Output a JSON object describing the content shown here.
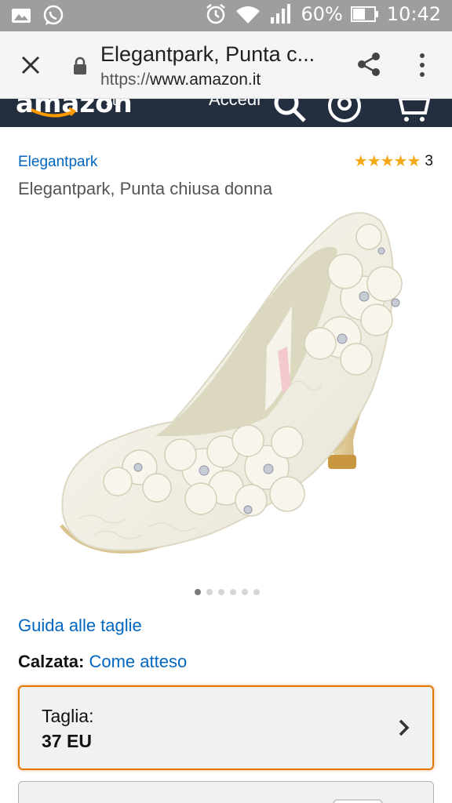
{
  "status_bar": {
    "battery_percent": "60%",
    "time": "10:42",
    "icons": [
      "image-icon",
      "whatsapp-icon",
      "alarm-icon",
      "wifi-icon",
      "signal-icon",
      "battery-icon"
    ]
  },
  "browser": {
    "title": "Elegantpark, Punta c...",
    "url_scheme": "https://",
    "url_host": "www.amazon.it",
    "icons": [
      "close-icon",
      "lock-icon",
      "share-icon",
      "more-vert-icon"
    ]
  },
  "amazon_header": {
    "logo_text": "amazon",
    "logo_tld": ".it",
    "account_text": "Accedi",
    "icons": [
      "search-icon",
      "user-icon",
      "cart-icon"
    ]
  },
  "product": {
    "brand": "Elegantpark",
    "title": "Elegantpark, Punta chiusa donna",
    "stars": "★★★★★",
    "rating_value": 5,
    "rating_count": "3",
    "image_count": 6,
    "active_image_index": 0
  },
  "size_guide_link": "Guida alle taglie",
  "fit": {
    "label": "Calzata:",
    "value": "Come atteso"
  },
  "size_selector": {
    "label": "Taglia:",
    "value": "37 EU"
  },
  "colors": {
    "link": "#0066c0",
    "star": "#f4a817",
    "amazon_dark": "#232f3e",
    "focus_border": "#e77600"
  }
}
